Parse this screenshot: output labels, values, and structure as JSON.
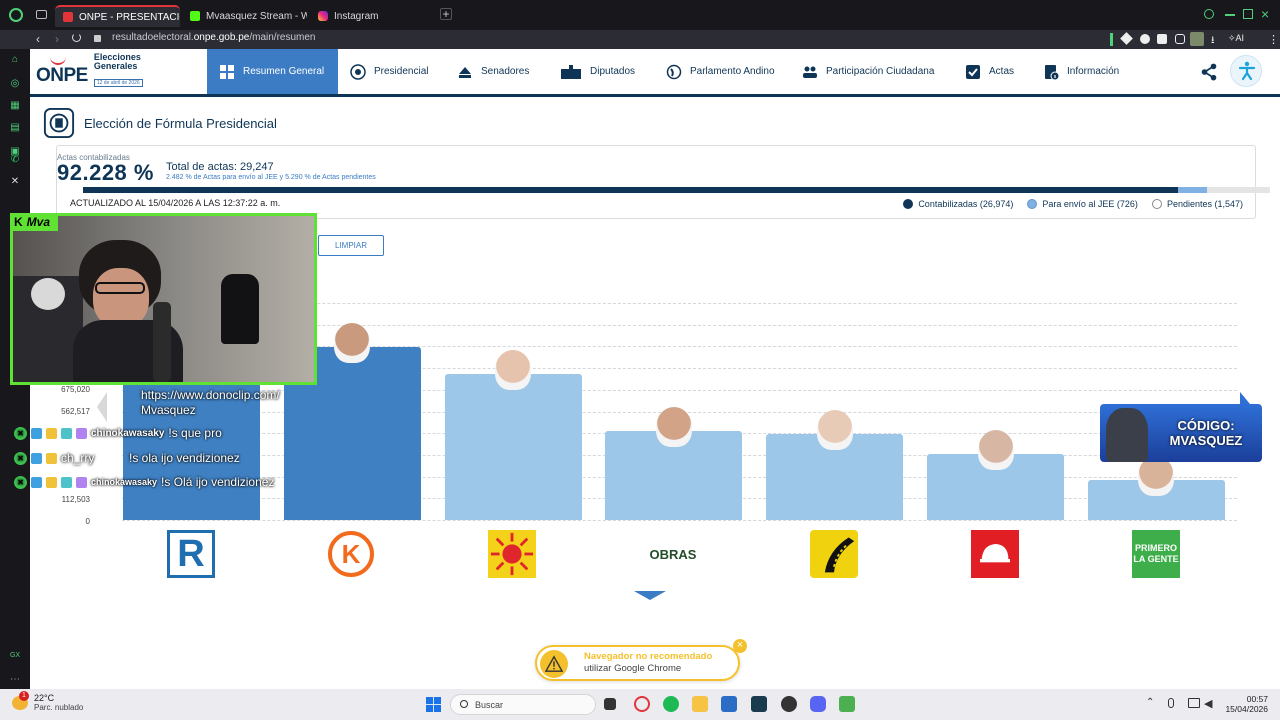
{
  "browser": {
    "tabs": [
      {
        "label": "ONPE - PRESENTACIÓN D",
        "active": true,
        "color": "#e0353a"
      },
      {
        "label": "Mvaasquez Stream - Walc",
        "active": false,
        "color": "#53fc18"
      },
      {
        "label": "Instagram",
        "active": false,
        "color": "#d6249f"
      }
    ],
    "new_tab": "+",
    "url_host": "resultadoelectoral.",
    "url_domain": "onpe.gob.pe",
    "url_path": "/main/resumen",
    "ai_label": "AI"
  },
  "site": {
    "logo": "ONPE",
    "logo_line1": "Elecciones",
    "logo_line2": "Generales",
    "logo_date": "12 de abril de 2026",
    "nav": [
      {
        "label": "Resumen General",
        "icon": "grid-icon",
        "active": true
      },
      {
        "label": "Presidencial",
        "icon": "seal-icon",
        "active": false
      },
      {
        "label": "Senadores",
        "icon": "senate-icon",
        "active": false
      },
      {
        "label": "Diputados",
        "icon": "building-icon",
        "active": false
      },
      {
        "label": "Parlamento Andino",
        "icon": "globe-icon",
        "active": false
      },
      {
        "label": "Participación Ciudadana",
        "icon": "people-icon",
        "active": false
      },
      {
        "label": "Actas",
        "icon": "check-icon",
        "active": false
      },
      {
        "label": "Información",
        "icon": "info-icon",
        "active": false
      }
    ],
    "section_title": "Elección de Fórmula Presidencial",
    "actas_label": "Actas contabilizadas",
    "actas_pct": "92.228 %",
    "total_actas": "Total de actas: 29,247",
    "actas_sub": "2.482 % de Actas para envío al JEE y 5.290 % de Actas pendientes",
    "progress": {
      "contabilizadas": 0.92228,
      "jee": 0.02482,
      "pendientes": 0.0529
    },
    "updated": "ACTUALIZADO AL 15/04/2026 A LAS 12:37:22 a. m.",
    "legend": [
      {
        "label": "Contabilizadas (26,974)",
        "color": "#0f3556"
      },
      {
        "label": "Para envío al JEE (726)",
        "color": "#7fb2e2"
      },
      {
        "label": "Pendientes (1,547)",
        "color": "#ffffff"
      }
    ],
    "clear_button": "LIMPIAR",
    "y_ticks": [
      "675,020",
      "562,517",
      "112,503",
      "0"
    ],
    "party_logos": [
      "R",
      "K",
      "sun",
      "OBRAS",
      "road",
      "helmet",
      "PRIMERO LA GENTE"
    ],
    "toast_title": "Navegador no recomendado",
    "toast_body": "utilizar Google Chrome",
    "toast_close": "×"
  },
  "chart_data": {
    "type": "bar",
    "categories": [
      "R",
      "K",
      "sun",
      "OBRAS",
      "road",
      "helmet",
      "PRIMERO LA GENTE"
    ],
    "values": [
      1040000,
      1030000,
      870000,
      530000,
      510000,
      390000,
      240000
    ],
    "ylim": [
      0,
      1360000
    ],
    "highlight_index": [
      0,
      1
    ]
  },
  "stream": {
    "cam_label": "Mva",
    "donation_url": "https://www.donoclip.com/",
    "donation_name": "Mvasquez",
    "chat": [
      {
        "user": "chinokawasaky",
        "text": "!s que pro"
      },
      {
        "user": "ch_rry",
        "text": "!s ola ijo vendizionez"
      },
      {
        "user": "chinokawasaky",
        "text": "!s Olá ijo vendizionez"
      }
    ],
    "promo": "CÓDIGO: MVASQUEZ"
  },
  "taskbar": {
    "temp": "22°C",
    "weather": "Parc. nublado",
    "weather_badge": "1",
    "search": "Buscar",
    "time": "00:57",
    "date": "15/04/2026"
  }
}
